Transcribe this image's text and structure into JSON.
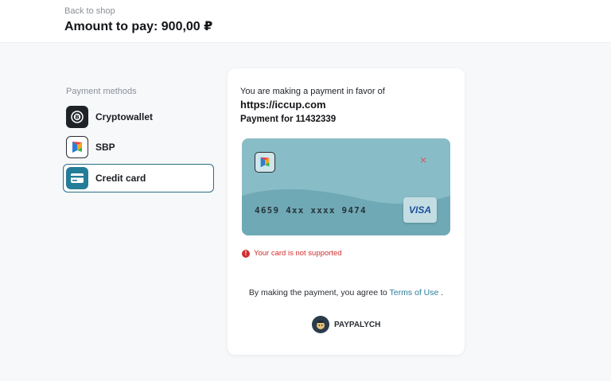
{
  "header": {
    "back_label": "Back to shop",
    "amount_label": "Amount to pay: 900,00 ₽"
  },
  "sidebar": {
    "title": "Payment methods",
    "items": [
      {
        "label": "Cryptowallet",
        "icon": "crypto-wallet-icon",
        "active": false
      },
      {
        "label": "SBP",
        "icon": "sbp-icon",
        "active": false
      },
      {
        "label": "Credit card",
        "icon": "credit-card-icon",
        "active": true
      }
    ]
  },
  "payment": {
    "favor_text": "You are making a payment in favor of",
    "site": "https://iccup.com",
    "payment_for": "Payment for 11432339"
  },
  "card": {
    "number": "4659 4xx xxxx 9474",
    "brand": "VISA",
    "close_symbol": "×"
  },
  "error": {
    "icon_symbol": "!",
    "message": "Your card is not supported"
  },
  "terms": {
    "prefix": "By making the payment, you agree to",
    "link": "Terms of Use",
    "suffix": "."
  },
  "provider": {
    "name": "PAYPALYCH"
  },
  "colors": {
    "accent": "#247d98",
    "error": "#d12e2e",
    "card_bg": "#88bcc6"
  }
}
